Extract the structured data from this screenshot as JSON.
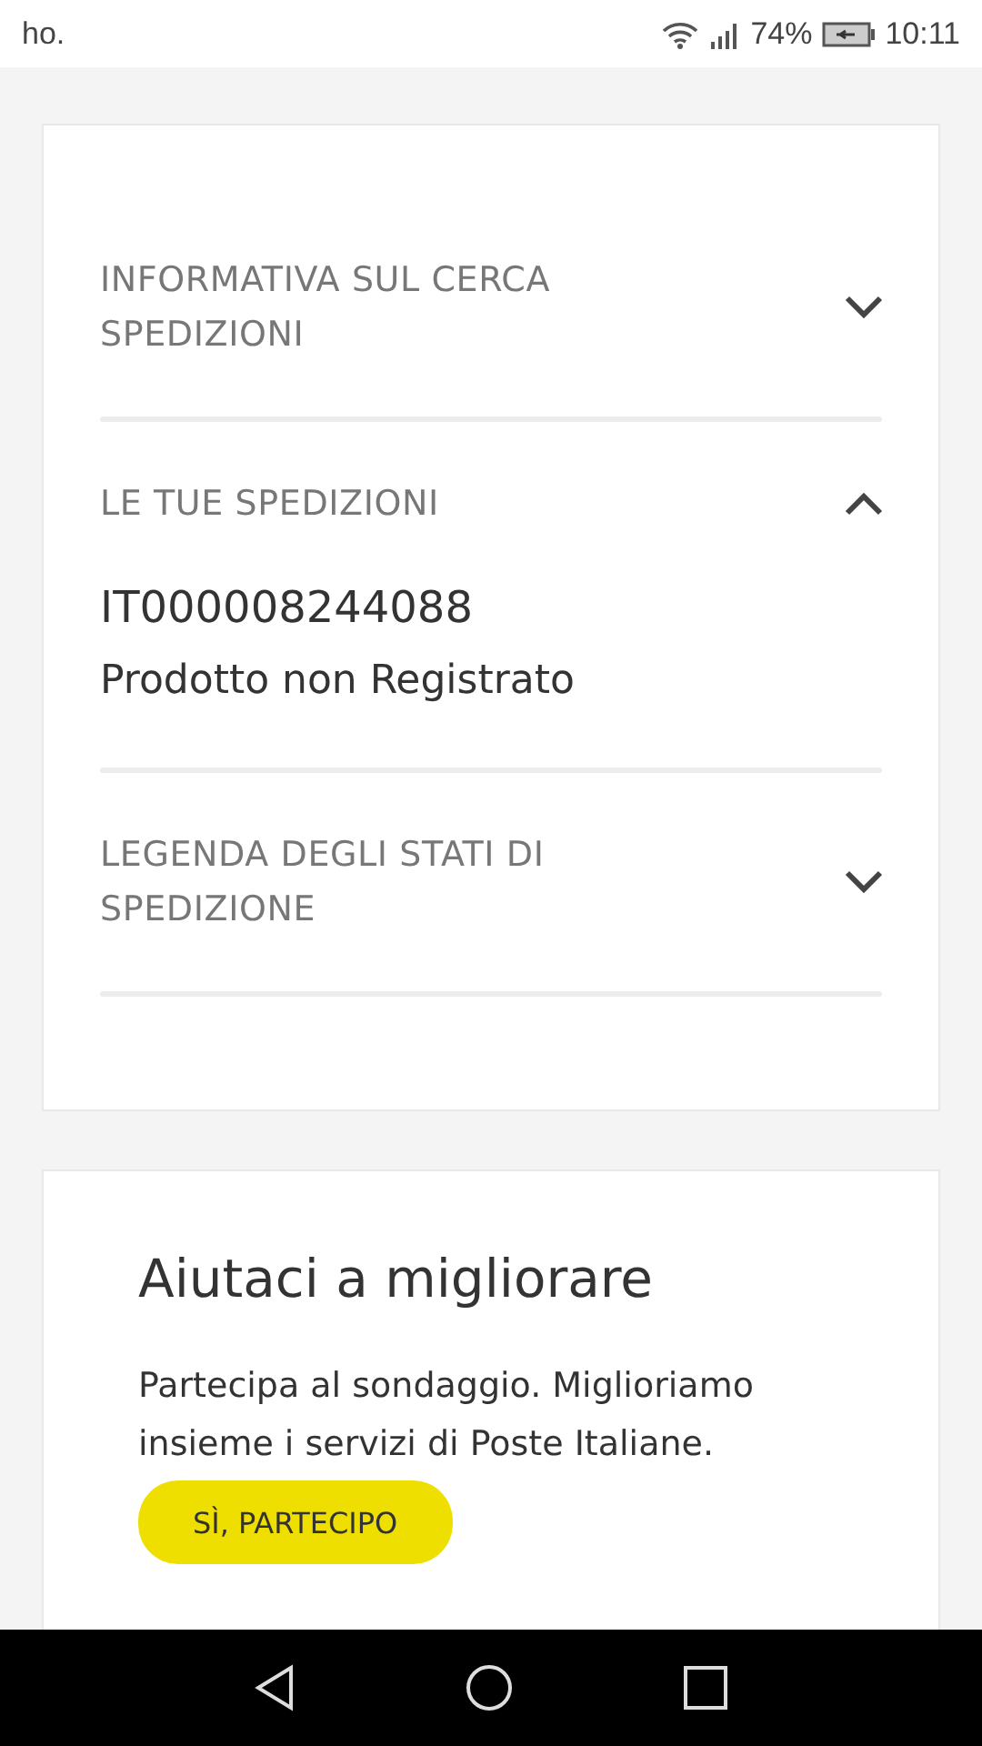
{
  "status_bar": {
    "left_text": "ho.",
    "battery": "74%",
    "time": "10:11"
  },
  "accordion": [
    {
      "title": "INFORMATIVA SUL CERCA SPEDIZIONI",
      "expanded": false
    },
    {
      "title": "LE TUE SPEDIZIONI",
      "expanded": true,
      "content": {
        "code": "IT000008244088",
        "status": "Prodotto non Registrato"
      }
    },
    {
      "title": "LEGENDA DEGLI STATI DI SPEDIZIONE",
      "expanded": false
    }
  ],
  "survey": {
    "title": "Aiutaci a migliorare",
    "text": "Partecipa al sondaggio. Miglioriamo insieme i servizi di Poste Italiane.",
    "button": "SÌ, PARTECIPO"
  }
}
